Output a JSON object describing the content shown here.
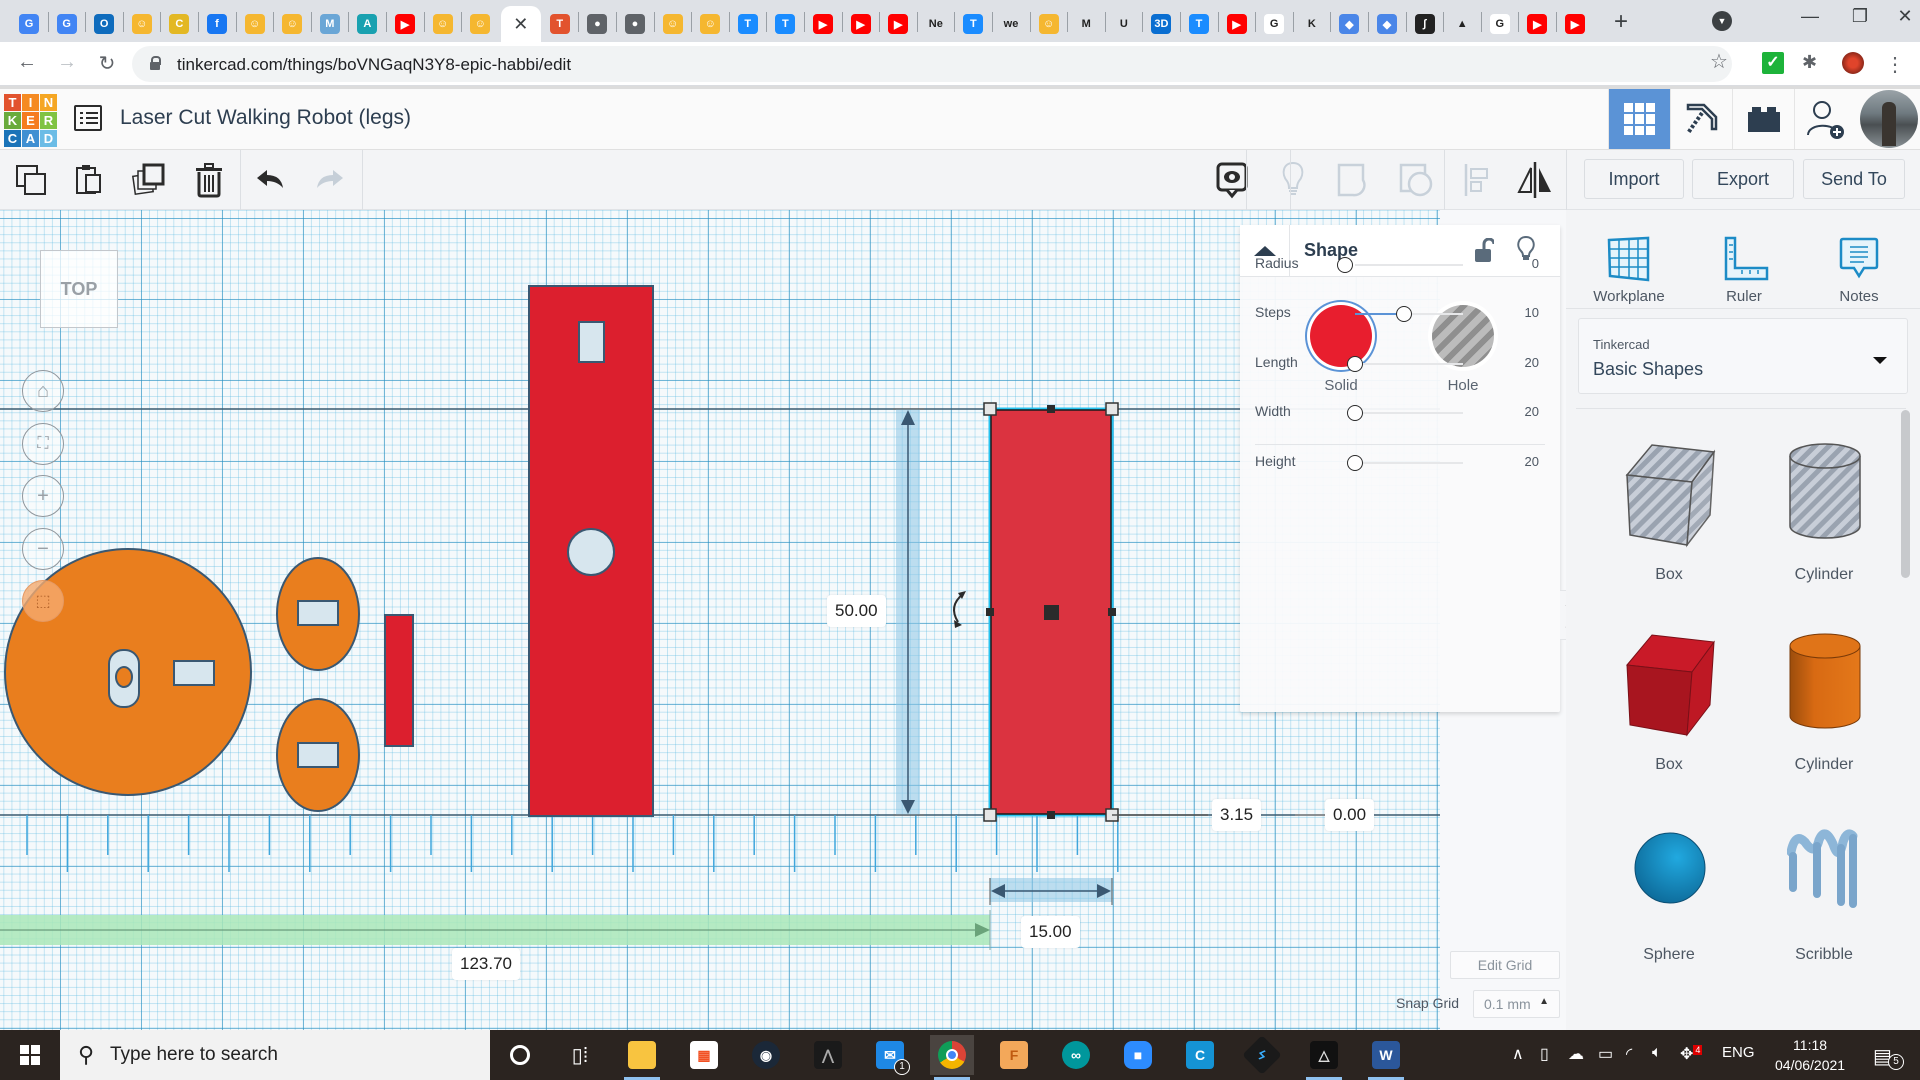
{
  "browser": {
    "tabs": [
      {
        "icon": "google-translate-icon",
        "color": "#4285f4",
        "glyph": "G"
      },
      {
        "icon": "google-translate-icon",
        "color": "#4285f4",
        "glyph": "G"
      },
      {
        "icon": "outlook-icon",
        "color": "#0f6cbd",
        "glyph": "O"
      },
      {
        "icon": "robot-avatar-icon",
        "color": "#f5b730",
        "glyph": "☺"
      },
      {
        "icon": "coin-icon",
        "color": "#e3b824",
        "glyph": "C"
      },
      {
        "icon": "facebook-icon",
        "color": "#1877f2",
        "glyph": "f"
      },
      {
        "icon": "robot-avatar-icon",
        "color": "#f5b730",
        "glyph": "☺"
      },
      {
        "icon": "robot-avatar-icon",
        "color": "#f5b730",
        "glyph": "☺"
      },
      {
        "icon": "maker-icon",
        "color": "#6aa6d6",
        "glyph": "M"
      },
      {
        "icon": "autodesk-icon",
        "color": "#19a1b0",
        "glyph": "A"
      },
      {
        "icon": "youtube-icon",
        "color": "#ff0000",
        "glyph": "▶"
      },
      {
        "icon": "robot-avatar-icon",
        "color": "#f5b730",
        "glyph": "☺"
      },
      {
        "icon": "robot-avatar-icon",
        "color": "#f5b730",
        "glyph": "☺"
      },
      {
        "icon": "close-icon",
        "color": "",
        "glyph": "✕",
        "active": true
      },
      {
        "icon": "tinkercad-icon",
        "color": "#e2532e",
        "glyph": "T"
      },
      {
        "icon": "globe-icon",
        "color": "#5f6368",
        "glyph": "●"
      },
      {
        "icon": "globe-icon",
        "color": "#5f6368",
        "glyph": "●"
      },
      {
        "icon": "robot-avatar-icon",
        "color": "#f5b730",
        "glyph": "☺"
      },
      {
        "icon": "robot-avatar-icon",
        "color": "#f5b730",
        "glyph": "☺"
      },
      {
        "icon": "t-icon",
        "color": "#1a8cff",
        "glyph": "T"
      },
      {
        "icon": "t-icon",
        "color": "#1a8cff",
        "glyph": "T"
      },
      {
        "icon": "youtube-icon",
        "color": "#ff0000",
        "glyph": "▶"
      },
      {
        "icon": "youtube-icon",
        "color": "#ff0000",
        "glyph": "▶"
      },
      {
        "icon": "youtube-icon",
        "color": "#ff0000",
        "glyph": "▶"
      },
      {
        "icon": "ne-icon",
        "color": "#dee1e6",
        "glyph": "Ne"
      },
      {
        "icon": "t-icon",
        "color": "#1a8cff",
        "glyph": "T"
      },
      {
        "icon": "wetransfer-icon",
        "color": "#dee1e6",
        "glyph": "we"
      },
      {
        "icon": "robot-avatar-icon",
        "color": "#f5b730",
        "glyph": "☺"
      },
      {
        "icon": "m-icon",
        "color": "#dee1e6",
        "glyph": "M"
      },
      {
        "icon": "u-icon",
        "color": "#dee1e6",
        "glyph": "U"
      },
      {
        "icon": "3d-icon",
        "color": "#0a6ed1",
        "glyph": "3D"
      },
      {
        "icon": "t-icon",
        "color": "#1a8cff",
        "glyph": "T"
      },
      {
        "icon": "youtube-icon",
        "color": "#ff0000",
        "glyph": "▶"
      },
      {
        "icon": "google-icon",
        "color": "#ffffff",
        "glyph": "G"
      },
      {
        "icon": "kiddom-icon",
        "color": "#dee1e6",
        "glyph": "K"
      },
      {
        "icon": "book-icon",
        "color": "#4a86e8",
        "glyph": "◆"
      },
      {
        "icon": "book-icon",
        "color": "#4a86e8",
        "glyph": "◆"
      },
      {
        "icon": "integral-icon",
        "color": "#222222",
        "glyph": "∫"
      },
      {
        "icon": "inkscape-icon",
        "color": "#dee1e6",
        "glyph": "▲"
      },
      {
        "icon": "google-icon",
        "color": "#ffffff",
        "glyph": "G"
      },
      {
        "icon": "youtube-icon",
        "color": "#ff0000",
        "glyph": "▶"
      },
      {
        "icon": "youtube-icon",
        "color": "#ff0000",
        "glyph": "▶"
      }
    ],
    "url": "tinkercad.com/things/boVNGaqN3Y8-epic-habbi/edit"
  },
  "header": {
    "logo_letters": [
      {
        "ch": "T",
        "color": "#e2532e"
      },
      {
        "ch": "I",
        "color": "#f58a22"
      },
      {
        "ch": "N",
        "color": "#f5a623"
      },
      {
        "ch": "K",
        "color": "#6aab3c"
      },
      {
        "ch": "E",
        "color": "#f57c20"
      },
      {
        "ch": "R",
        "color": "#80c342"
      },
      {
        "ch": "C",
        "color": "#1a73b8"
      },
      {
        "ch": "A",
        "color": "#3f8fd2"
      },
      {
        "ch": "D",
        "color": "#6bbce6"
      }
    ],
    "title": "Laser Cut Walking Robot (legs)",
    "accent": "#5b93d6"
  },
  "toolbar": {
    "import_label": "Import",
    "export_label": "Export",
    "send_to_label": "Send To"
  },
  "canvas": {
    "view_cube_label": "TOP",
    "measurements": {
      "length": "50.00",
      "width": "15.00",
      "offset_x": "123.70",
      "elevation": "3.15",
      "rotation_offset": "0.00"
    },
    "colors": {
      "solid_red": "#dc1f2e",
      "selected_red": "#db3340",
      "orange": "#e97e1e",
      "selection_outline": "#27c4f0",
      "green_guide": "#a9e8b8"
    }
  },
  "inspector": {
    "title": "Shape",
    "solid_label": "Solid",
    "hole_label": "Hole",
    "solid_color": "#e81e2e",
    "properties": [
      {
        "label": "Radius",
        "value": "0",
        "min": 0,
        "max": 50,
        "fraction": 0.0
      },
      {
        "label": "Steps",
        "value": "10",
        "min": 0,
        "max": 20,
        "fraction": 0.45
      },
      {
        "label": "Length",
        "value": "20",
        "min": 20,
        "max": 200,
        "fraction": 0.0
      },
      {
        "label": "Width",
        "value": "20",
        "min": 20,
        "max": 200,
        "fraction": 0.0
      },
      {
        "label": "Height",
        "value": "20",
        "min": 20,
        "max": 200,
        "fraction": 0.0
      }
    ],
    "edit_grid_label": "Edit Grid",
    "snap_grid_label": "Snap Grid",
    "snap_grid_value": "0.1 mm"
  },
  "right_panel": {
    "tools": [
      {
        "label": "Workplane",
        "icon": "workplane-icon"
      },
      {
        "label": "Ruler",
        "icon": "ruler-icon"
      },
      {
        "label": "Notes",
        "icon": "notes-icon"
      }
    ],
    "library_small": "Tinkercad",
    "library_name": "Basic Shapes",
    "shapes": [
      {
        "label": "Box",
        "kind": "box-hole"
      },
      {
        "label": "Cylinder",
        "kind": "cylinder-hole"
      },
      {
        "label": "Box",
        "kind": "box"
      },
      {
        "label": "Cylinder",
        "kind": "cylinder"
      },
      {
        "label": "Sphere",
        "kind": "sphere"
      },
      {
        "label": "Scribble",
        "kind": "scribble"
      }
    ]
  },
  "taskbar": {
    "search_placeholder": "Type here to search",
    "language": "ENG",
    "time": "11:18",
    "date": "04/06/2021",
    "notification_count": "5",
    "mail_badge": "1",
    "tray_badge": "4"
  }
}
